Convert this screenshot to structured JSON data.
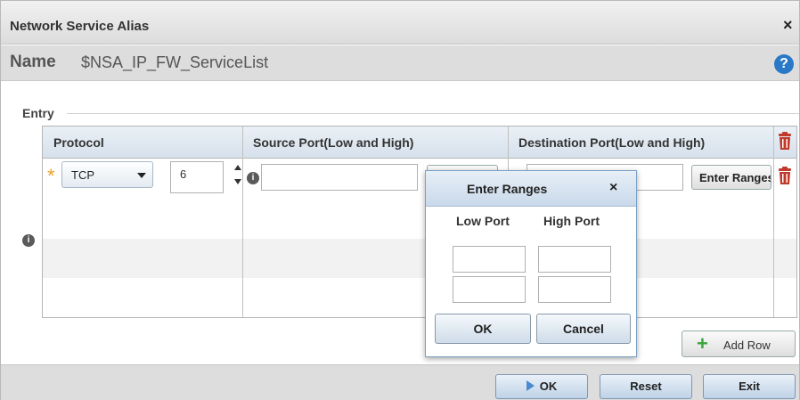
{
  "dialog": {
    "title": "Network Service Alias",
    "close_glyph": "×"
  },
  "name_bar": {
    "label": "Name",
    "value": "$NSA_IP_FW_ServiceList",
    "help_icon": "help-icon",
    "help_glyph": "?"
  },
  "entry": {
    "legend": "Entry",
    "columns": [
      "Protocol",
      "Source Port(Low and High)",
      "Destination Port(Low and High)"
    ],
    "row": {
      "required_glyph": "*",
      "protocol": "TCP",
      "protocol_number": "6",
      "source_button": "Enter Ranges",
      "destination_button": "Enter Ranges"
    },
    "info_glyph": "i"
  },
  "popup": {
    "title": "Enter Ranges",
    "close_glyph": "×",
    "low_label": "Low Port",
    "high_label": "High Port",
    "ok": "OK",
    "cancel": "Cancel"
  },
  "add_row": {
    "plus_glyph": "+",
    "label": "Add Row"
  },
  "footer": {
    "ok": "OK",
    "reset": "Reset",
    "exit": "Exit"
  },
  "colors": {
    "accent_blue": "#2a78c8",
    "star": "#f0a020",
    "trash_red": "#c0392b",
    "add_green": "#3aa53a"
  }
}
